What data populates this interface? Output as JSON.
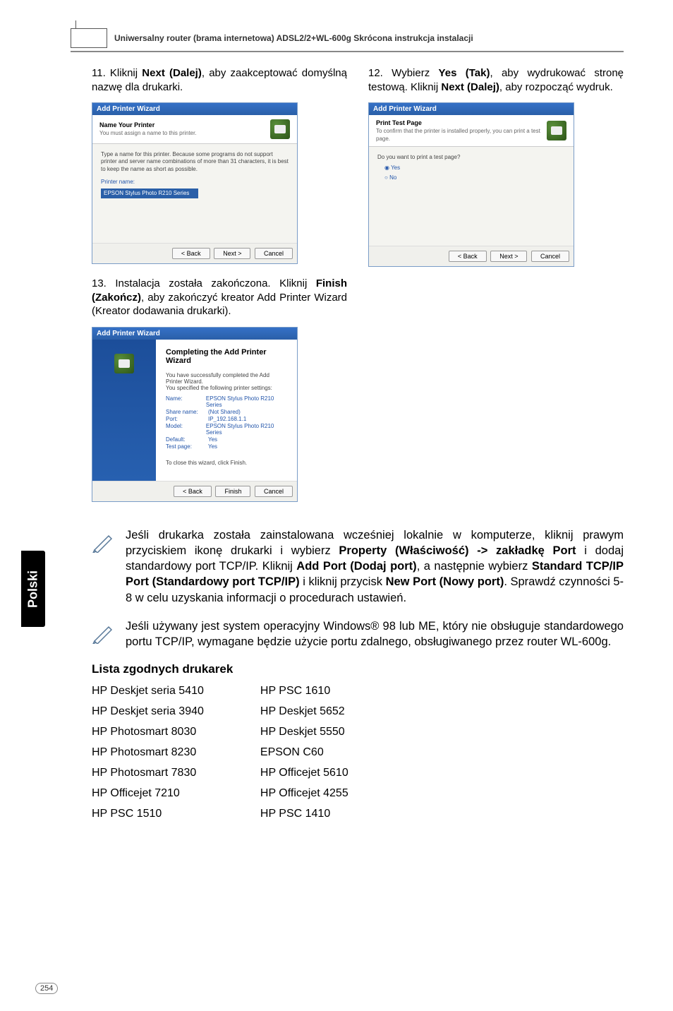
{
  "header": {
    "title": "Uniwersalny router (brama internetowa) ADSL2/2+WL-600g  Skrócona instrukcja instalacji"
  },
  "steps": {
    "s11": "11. Kliknij <b>Next (Dalej)</b>, aby zaakceptować domyślną nazwę dla drukarki.",
    "s12": "12. Wybierz <b>Yes (Tak)</b>, aby wydrukować stronę testową. Kliknij <b>Next (Dalej)</b>, aby rozpocząć wydruk.",
    "s13": "13. Instalacja została zakończona. Kliknij <b>Finish (Zakończ)</b>, aby zakończyć kreator Add Printer Wizard (Kreator dodawania drukarki)."
  },
  "wizard": {
    "title": "Add Printer Wizard",
    "w11": {
      "heading": "Name Your Printer",
      "sub": "You must assign a name to this printer.",
      "body": "Type a name for this printer. Because some programs do not support printer and server name combinations of more than 31 characters, it is best to keep the name as short as possible.",
      "label": "Printer name:",
      "value": "EPSON Stylus Photo R210 Series"
    },
    "w12": {
      "heading": "Print Test Page",
      "sub": "To confirm that the printer is installed properly, you can print a test page.",
      "body": "Do you want to print a test page?",
      "opt_yes": "Yes",
      "opt_no": "No"
    },
    "w13": {
      "heading": "Completing the Add Printer Wizard",
      "sub1": "You have successfully completed the Add Printer Wizard.",
      "sub2": "You specified the following printer settings:",
      "rows": [
        {
          "k": "Name:",
          "v": "EPSON Stylus Photo R210 Series"
        },
        {
          "k": "Share name:",
          "v": "(Not Shared)"
        },
        {
          "k": "Port:",
          "v": "IP_192.168.1.1"
        },
        {
          "k": "Model:",
          "v": "EPSON Stylus Photo R210 Series"
        },
        {
          "k": "Default:",
          "v": "Yes"
        },
        {
          "k": "Test page:",
          "v": "Yes"
        }
      ],
      "closing": "To close this wizard, click Finish."
    },
    "buttons": {
      "back": "< Back",
      "next": "Next >",
      "finish": "Finish",
      "cancel": "Cancel"
    }
  },
  "notes": {
    "n1": "Jeśli drukarka została zainstalowana wcześniej lokalnie w komputerze, kliknij prawym przyciskiem ikonę drukarki i wybierz <b>Property (Właściwość) -> zakładkę Port</b> i dodaj standardowy port TCP/IP. Kliknij <b>Add Port (Dodaj port)</b>, a następnie wybierz <b>Standard TCP/IP Port (Standardowy port TCP/IP)</b> i kliknij przycisk <b>New Port (Nowy port)</b>. Sprawdź czynności 5-8 w celu uzyskania informacji o procedurach ustawień.",
    "n2": "Jeśli używany jest system operacyjny Windows® 98 lub ME, który nie obsługuje standardowego portu TCP/IP, wymagane będzie użycie portu zdalnego, obsługiwanego przez router WL-600g."
  },
  "list_heading": "Lista zgodnych drukarek",
  "printers_left": [
    "HP Deskjet seria 5410",
    "HP Deskjet seria 3940",
    "HP Photosmart 8030",
    "HP Photosmart 8230",
    "HP Photosmart 7830",
    "HP Officejet  7210",
    "HP PSC 1510"
  ],
  "printers_right": [
    "HP PSC 1610",
    "HP Deskjet 5652",
    "HP Deskjet 5550",
    "EPSON C60",
    "HP Officejet 5610",
    "HP Officejet 4255",
    "HP  PSC 1410"
  ],
  "side_tab": "Polski",
  "page_number": "254"
}
